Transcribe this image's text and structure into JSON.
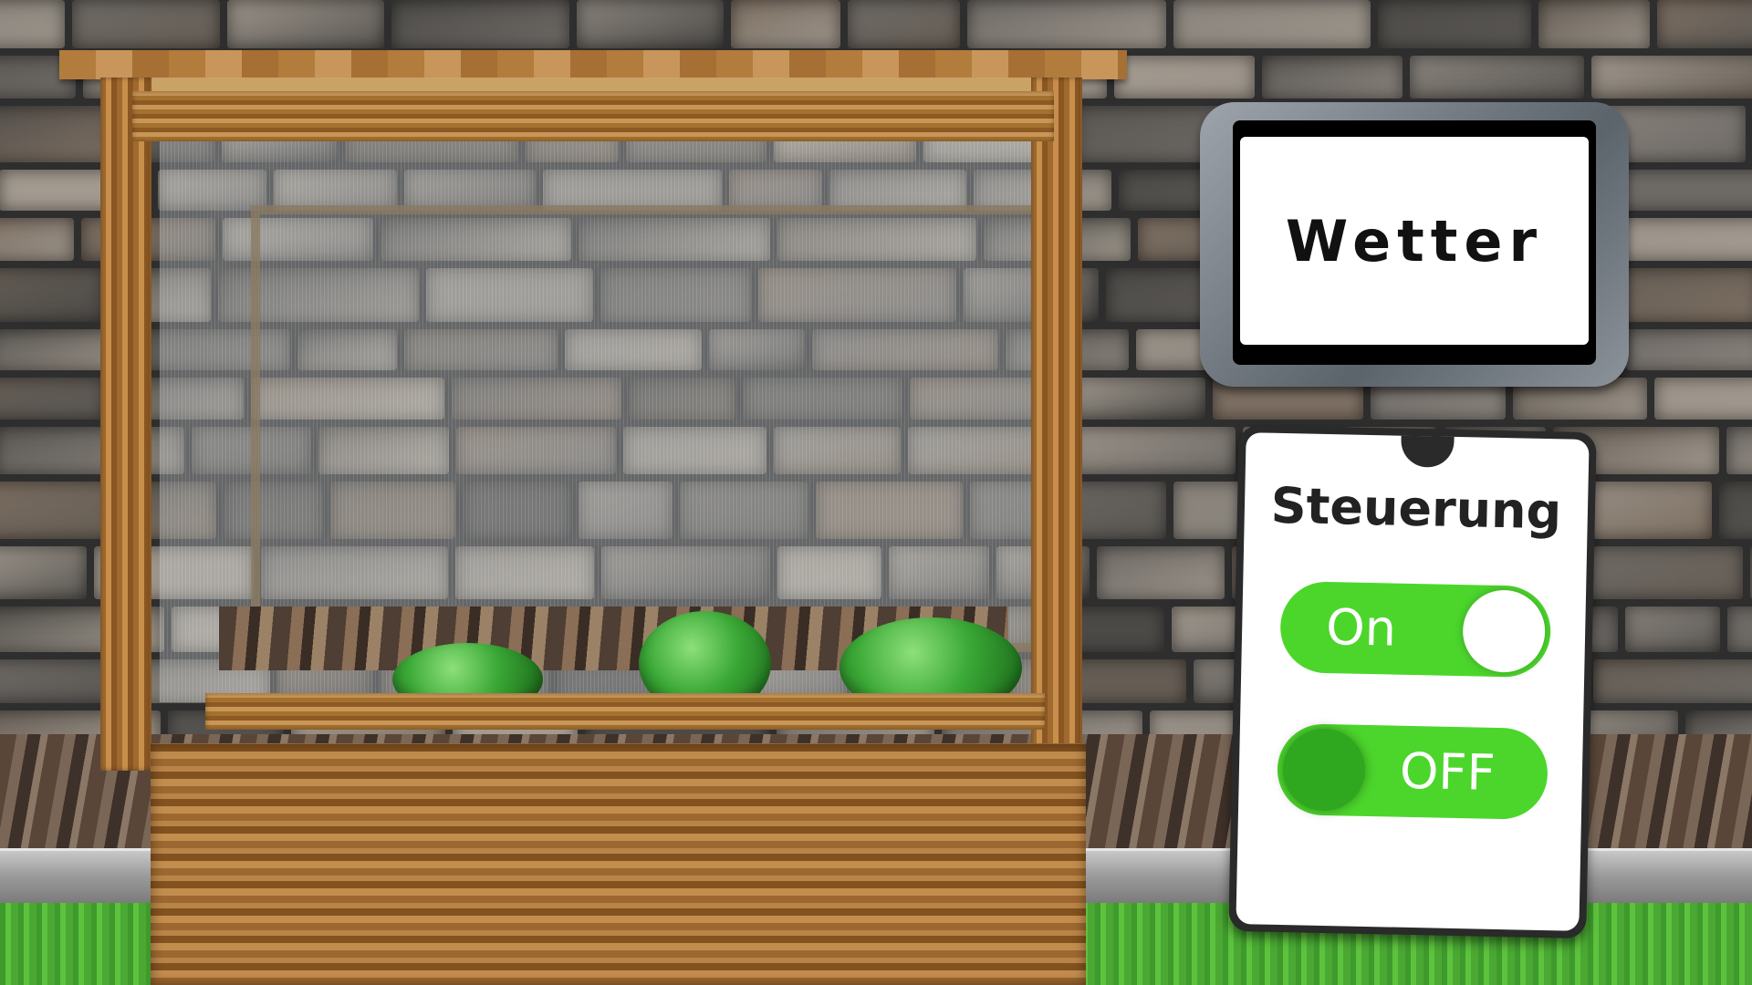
{
  "weather_sign": {
    "label": "Wetter"
  },
  "control_panel": {
    "title": "Steuerung",
    "toggle_on": {
      "label": "On",
      "state": "on"
    },
    "toggle_off": {
      "label": "OFF",
      "state": "off"
    }
  },
  "colors": {
    "toggle_track": "#4cd62c",
    "toggle_knob_off": "#2fa820",
    "sign_frame": "#6b737b"
  }
}
